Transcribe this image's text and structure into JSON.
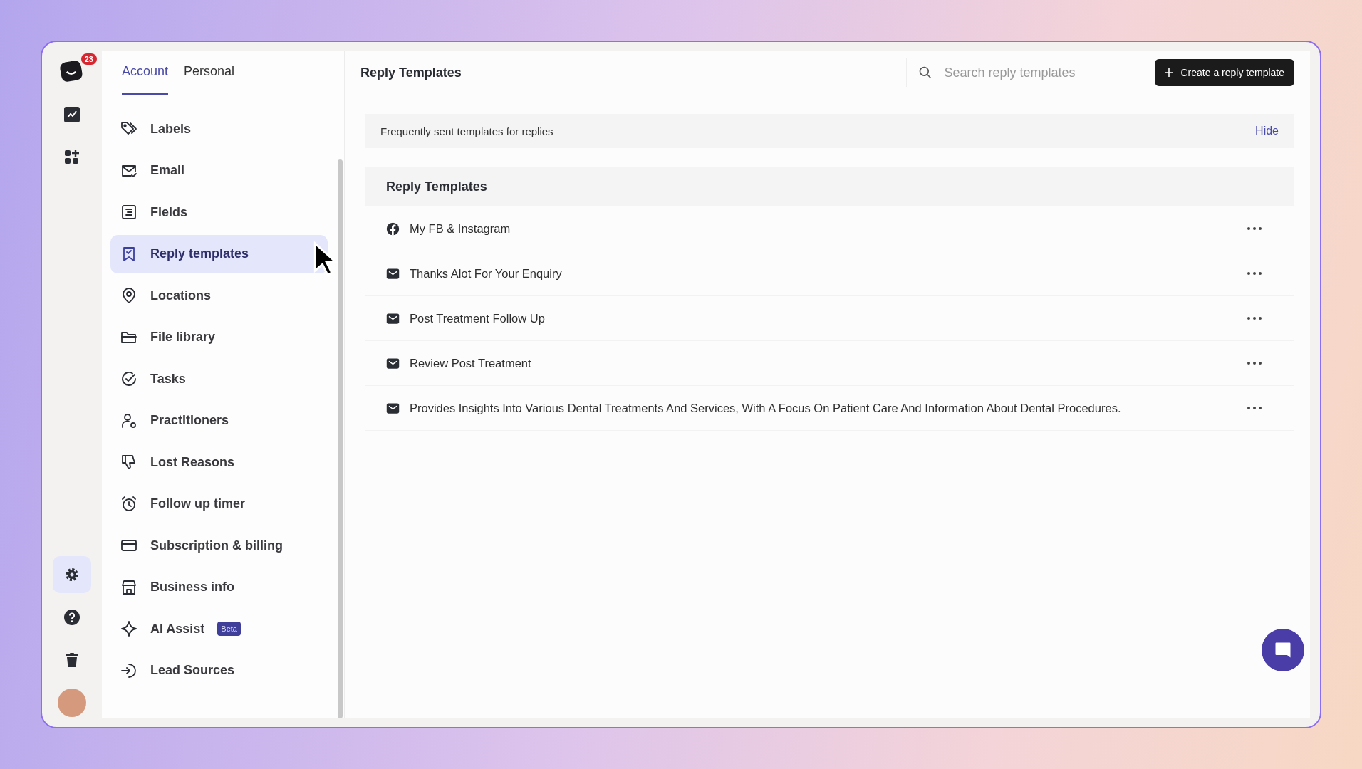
{
  "rail": {
    "notification_count": "23",
    "items": [
      {
        "kind": "chart",
        "selected": false
      },
      {
        "kind": "apps",
        "selected": false
      }
    ],
    "bottom_items": [
      {
        "kind": "settings",
        "selected": true
      },
      {
        "kind": "help",
        "selected": false
      },
      {
        "kind": "trash",
        "selected": false
      }
    ]
  },
  "tabs": [
    {
      "label": "Account",
      "selected": true
    },
    {
      "label": "Personal",
      "selected": false
    }
  ],
  "sidebar": {
    "items": [
      {
        "label": "Labels",
        "kind": "tag",
        "selected": false
      },
      {
        "label": "Email",
        "kind": "mail",
        "selected": false
      },
      {
        "label": "Fields",
        "kind": "list",
        "selected": false
      },
      {
        "label": "Reply templates",
        "kind": "bookmark",
        "selected": true
      },
      {
        "label": "Locations",
        "kind": "pin",
        "selected": false
      },
      {
        "label": "File library",
        "kind": "folder",
        "selected": false
      },
      {
        "label": "Tasks",
        "kind": "check",
        "selected": false
      },
      {
        "label": "Practitioners",
        "kind": "person",
        "selected": false
      },
      {
        "label": "Lost Reasons",
        "kind": "thumbdown",
        "selected": false
      },
      {
        "label": "Follow up timer",
        "kind": "alarm",
        "selected": false
      },
      {
        "label": "Subscription & billing",
        "kind": "card",
        "selected": false
      },
      {
        "label": "Business info",
        "kind": "store",
        "selected": false
      },
      {
        "label": "AI Assist",
        "kind": "sparkle",
        "selected": false,
        "badge": "Beta"
      },
      {
        "label": "Lead Sources",
        "kind": "enter",
        "selected": false
      }
    ]
  },
  "header": {
    "title": "Reply Templates",
    "search": {
      "placeholder": "Search reply templates"
    },
    "create_button": "Create a reply template"
  },
  "banner": {
    "text": "Frequently sent templates for replies",
    "action": "Hide"
  },
  "templates": {
    "title": "Reply Templates",
    "rows": [
      {
        "kind": "facebook",
        "name": "My FB & Instagram"
      },
      {
        "kind": "email",
        "name": "Thanks Alot For Your Enquiry"
      },
      {
        "kind": "email",
        "name": "Post Treatment Follow Up"
      },
      {
        "kind": "email",
        "name": "Review Post Treatment"
      },
      {
        "kind": "email",
        "name": "Provides Insights Into Various Dental Treatments And Services, With A Focus On Patient Care And Information About Dental Procedures."
      }
    ]
  }
}
